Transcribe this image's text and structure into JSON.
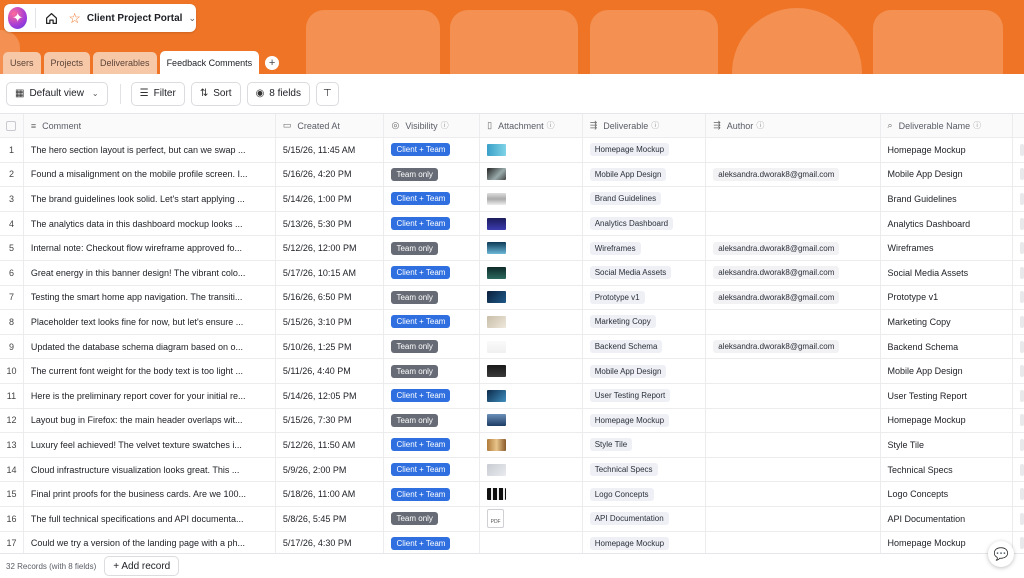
{
  "app": {
    "title": "Client Project Portal"
  },
  "tabs": [
    {
      "label": "Users",
      "active": false
    },
    {
      "label": "Projects",
      "active": false
    },
    {
      "label": "Deliverables",
      "active": false
    },
    {
      "label": "Feedback Comments",
      "active": true
    }
  ],
  "toolbar": {
    "view": "Default view",
    "filter": "Filter",
    "sort": "Sort",
    "fields": "8 fields"
  },
  "columns": [
    "Comment",
    "Created At",
    "Visibility",
    "Attachment",
    "Deliverable",
    "Author",
    "Deliverable Name"
  ],
  "colors": {
    "accent": "#ef7426",
    "client_team": "#2f6fdf",
    "team_only": "#666b75"
  },
  "rows": [
    {
      "n": "1",
      "comment": "The hero section layout is perfect, but can we swap ...",
      "created": "5/15/26, 11:45 AM",
      "visibility": "Client + Team",
      "thumb": "linear-gradient(90deg,#3aa0c8,#7fd3e6)",
      "deliverable": "Homepage Mockup",
      "author": "",
      "name": "Homepage Mockup"
    },
    {
      "n": "2",
      "comment": "Found a misalignment on the mobile profile screen. I...",
      "created": "5/16/26, 4:20 PM",
      "visibility": "Team only",
      "thumb": "linear-gradient(135deg,#222,#9aa 60%,#444)",
      "deliverable": "Mobile App Design",
      "author": "aleksandra.dworak8@gmail.com",
      "name": "Mobile App Design"
    },
    {
      "n": "3",
      "comment": "The brand guidelines look solid. Let's start applying ...",
      "created": "5/14/26, 1:00 PM",
      "visibility": "Client + Team",
      "thumb": "linear-gradient(180deg,#ddd,#aaa 50%,#eee)",
      "deliverable": "Brand Guidelines",
      "author": "",
      "name": "Brand Guidelines"
    },
    {
      "n": "4",
      "comment": "The analytics data in this dashboard mockup looks ...",
      "created": "5/13/26, 5:30 PM",
      "visibility": "Client + Team",
      "thumb": "linear-gradient(180deg,#1c1c5c,#3b3bb0)",
      "deliverable": "Analytics Dashboard",
      "author": "",
      "name": "Analytics Dashboard"
    },
    {
      "n": "5",
      "comment": "Internal note: Checkout flow wireframe approved fo...",
      "created": "5/12/26, 12:00 PM",
      "visibility": "Team only",
      "thumb": "linear-gradient(180deg,#0d3a55,#6cb7d8)",
      "deliverable": "Wireframes",
      "author": "aleksandra.dworak8@gmail.com",
      "name": "Wireframes"
    },
    {
      "n": "6",
      "comment": "Great energy in this banner design! The vibrant colo...",
      "created": "5/17/26, 10:15 AM",
      "visibility": "Client + Team",
      "thumb": "linear-gradient(180deg,#0f2a2a,#2b6a5e)",
      "deliverable": "Social Media Assets",
      "author": "aleksandra.dworak8@gmail.com",
      "name": "Social Media Assets"
    },
    {
      "n": "7",
      "comment": "Testing the smart home app navigation. The transiti...",
      "created": "5/16/26, 6:50 PM",
      "visibility": "Team only",
      "thumb": "linear-gradient(135deg,#0b1f3a,#1f5a8a)",
      "deliverable": "Prototype v1",
      "author": "aleksandra.dworak8@gmail.com",
      "name": "Prototype v1"
    },
    {
      "n": "8",
      "comment": "Placeholder text looks fine for now, but let's ensure ...",
      "created": "5/15/26, 3:10 PM",
      "visibility": "Client + Team",
      "thumb": "linear-gradient(135deg,#c9bda8,#efe8dc)",
      "deliverable": "Marketing Copy",
      "author": "",
      "name": "Marketing Copy"
    },
    {
      "n": "9",
      "comment": "Updated the database schema diagram based on o...",
      "created": "5/10/26, 1:25 PM",
      "visibility": "Team only",
      "thumb": "linear-gradient(180deg,#fafafa,#f0f0f0)",
      "deliverable": "Backend Schema",
      "author": "aleksandra.dworak8@gmail.com",
      "name": "Backend Schema"
    },
    {
      "n": "10",
      "comment": "The current font weight for the body text is too light ...",
      "created": "5/11/26, 4:40 PM",
      "visibility": "Team only",
      "thumb": "linear-gradient(180deg,#1a1a1a,#3a3a3a)",
      "deliverable": "Mobile App Design",
      "author": "",
      "name": "Mobile App Design"
    },
    {
      "n": "11",
      "comment": "Here is the preliminary report cover for your initial re...",
      "created": "5/14/26, 12:05 PM",
      "visibility": "Client + Team",
      "thumb": "linear-gradient(135deg,#0d2a4a,#3f8fc0)",
      "deliverable": "User Testing Report",
      "author": "",
      "name": "User Testing Report"
    },
    {
      "n": "12",
      "comment": "Layout bug in Firefox: the main header overlaps wit...",
      "created": "5/15/26, 7:30 PM",
      "visibility": "Team only",
      "thumb": "linear-gradient(180deg,#6a8fb8,#1e3d66)",
      "deliverable": "Homepage Mockup",
      "author": "",
      "name": "Homepage Mockup"
    },
    {
      "n": "13",
      "comment": "Luxury feel achieved! The velvet texture swatches i...",
      "created": "5/12/26, 11:50 AM",
      "visibility": "Client + Team",
      "thumb": "linear-gradient(90deg,#b07a3a,#e8c48a,#8a5a2a)",
      "deliverable": "Style Tile",
      "author": "",
      "name": "Style Tile"
    },
    {
      "n": "14",
      "comment": "Cloud infrastructure visualization looks great. This ...",
      "created": "5/9/26, 2:00 PM",
      "visibility": "Client + Team",
      "thumb": "linear-gradient(135deg,#c8ccd2,#e9ebee)",
      "deliverable": "Technical Specs",
      "author": "",
      "name": "Technical Specs"
    },
    {
      "n": "15",
      "comment": "Final print proofs for the business cards. Are we 100...",
      "created": "5/18/26, 11:00 AM",
      "visibility": "Client + Team",
      "thumb": "repeating-linear-gradient(90deg,#111 0 4px,#eee 4px 6px)",
      "deliverable": "Logo Concepts",
      "author": "",
      "name": "Logo Concepts"
    },
    {
      "n": "16",
      "comment": "The full technical specifications and API documenta...",
      "created": "5/8/26, 5:45 PM",
      "visibility": "Team only",
      "thumb": "pdf",
      "deliverable": "API Documentation",
      "author": "",
      "name": "API Documentation"
    },
    {
      "n": "17",
      "comment": "Could we try a version of the landing page with a ph...",
      "created": "5/17/26, 4:30 PM",
      "visibility": "Client + Team",
      "thumb": "",
      "deliverable": "Homepage Mockup",
      "author": "",
      "name": "Homepage Mockup"
    }
  ],
  "footer": {
    "count": "32 Records (with 8 fields)",
    "add": "+ Add record"
  }
}
